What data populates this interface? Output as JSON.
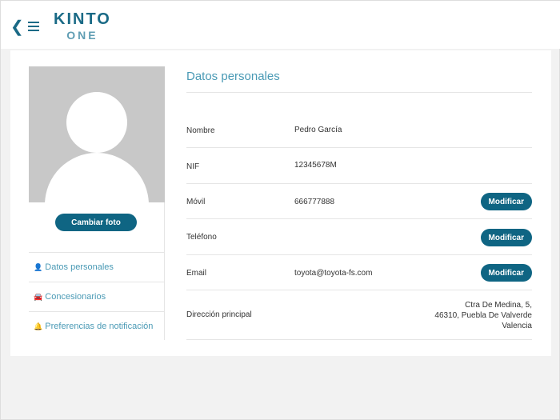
{
  "header": {
    "back_icon": "chevron-left",
    "menu_icon": "hamburger",
    "logo_top": "KINTO",
    "logo_bottom": "ONE"
  },
  "profile": {
    "change_photo": "Cambiar foto"
  },
  "nav": [
    {
      "icon": "user-icon",
      "glyph": "👤",
      "label": "Datos personales"
    },
    {
      "icon": "car-icon",
      "glyph": "🚘",
      "label": "Concesionarios"
    },
    {
      "icon": "bell-icon",
      "glyph": "🔔",
      "label": "Preferencias de notificación"
    }
  ],
  "section_title": "Datos personales",
  "fields": [
    {
      "label": "Nombre",
      "value": "Pedro García"
    },
    {
      "label": "NIF",
      "value": "12345678M"
    },
    {
      "label": "Móvil",
      "value": "666777888",
      "action": "Modificar"
    },
    {
      "label": "Teléfono",
      "value": "",
      "action": "Modificar"
    },
    {
      "label": "Email",
      "value": "toyota@toyota-fs.com",
      "action": "Modificar"
    },
    {
      "label": "Dirección principal",
      "address": [
        "Ctra De Medina, 5,",
        "46310, Puebla De Valverde",
        "Valencia"
      ]
    }
  ]
}
